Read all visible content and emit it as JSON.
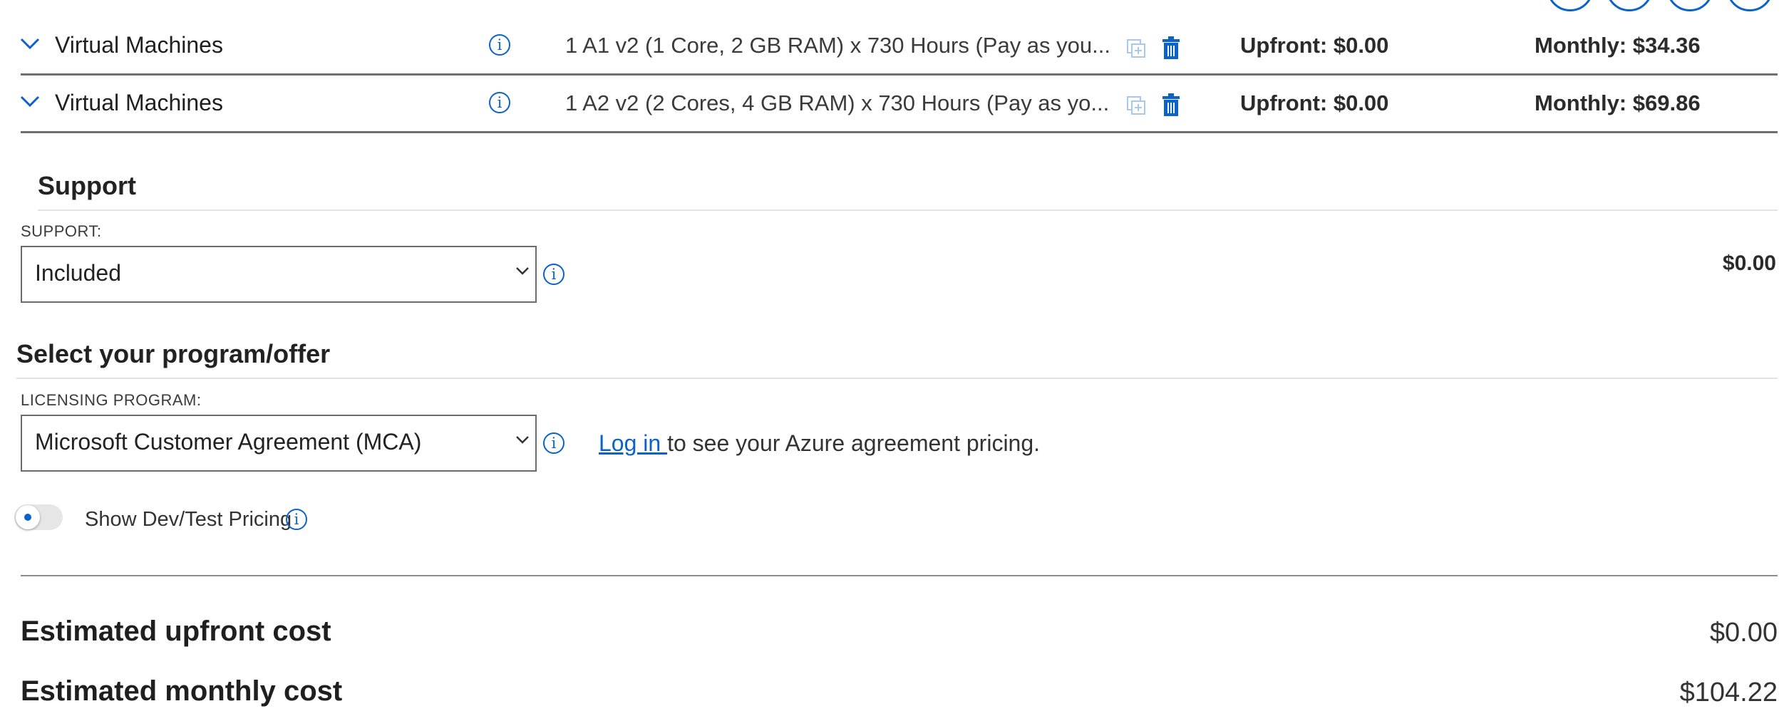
{
  "rows": [
    {
      "service": "Virtual Machines",
      "description": "1 A1 v2 (1 Core, 2 GB RAM) x 730 Hours (Pay as you...",
      "upfront": "Upfront: $0.00",
      "monthly": "Monthly: $34.36"
    },
    {
      "service": "Virtual Machines",
      "description": "1 A2 v2 (2 Cores, 4 GB RAM) x 730 Hours (Pay as yo...",
      "upfront": "Upfront: $0.00",
      "monthly": "Monthly: $69.86"
    }
  ],
  "support": {
    "title": "Support",
    "label": "SUPPORT:",
    "selected": "Included",
    "price": "$0.00"
  },
  "program": {
    "title": "Select your program/offer",
    "label": "LICENSING PROGRAM:",
    "selected": "Microsoft Customer Agreement (MCA)",
    "login_link": "Log in ",
    "login_text": "to see your Azure agreement pricing."
  },
  "devtest": {
    "label": "Show Dev/Test Pricing",
    "enabled": false
  },
  "totals": {
    "upfront_label": "Estimated upfront cost",
    "upfront_value": "$0.00",
    "monthly_label": "Estimated monthly cost",
    "monthly_value": "$104.22"
  },
  "icons": {
    "info": "info-icon",
    "chevron": "chevron-down-icon",
    "clone": "clone-icon",
    "delete": "trash-icon"
  },
  "colors": {
    "accent": "#0b63c9",
    "text": "#1f1f1f"
  }
}
